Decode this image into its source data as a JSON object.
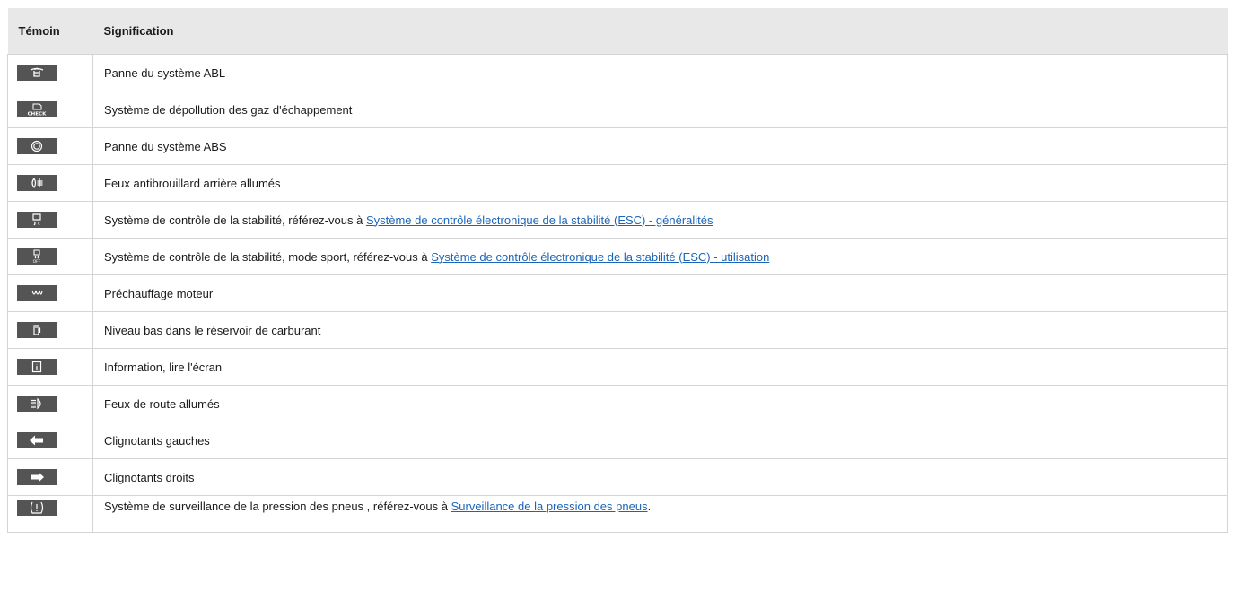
{
  "table": {
    "headers": {
      "temoin": "Témoin",
      "signification": "Signification"
    },
    "rows": [
      {
        "icon": "abl-lamp-fault-icon",
        "text": "Panne du système ABL",
        "link": "",
        "after": ""
      },
      {
        "icon": "engine-check-icon",
        "text": "Système de dépollution des gaz d'échappement",
        "link": "",
        "after": ""
      },
      {
        "icon": "abs-icon",
        "text": "Panne du système ABS",
        "link": "",
        "after": ""
      },
      {
        "icon": "rear-fog-light-icon",
        "text": "Feux antibrouillard arrière allumés",
        "link": "",
        "after": ""
      },
      {
        "icon": "stability-control-icon",
        "text": "Système de contrôle de la stabilité, référez-vous à ",
        "link": "Système de contrôle électronique de la stabilité (ESC) - généralités",
        "after": ""
      },
      {
        "icon": "stability-control-off-icon",
        "text": "Système de contrôle de la stabilité, mode sport, référez-vous à ",
        "link": "Système de contrôle électronique de la stabilité (ESC) - utilisation",
        "after": ""
      },
      {
        "icon": "glow-plug-icon",
        "text": "Préchauffage moteur",
        "link": "",
        "after": ""
      },
      {
        "icon": "fuel-pump-icon",
        "text": "Niveau bas dans le réservoir de carburant",
        "link": "",
        "after": ""
      },
      {
        "icon": "information-icon",
        "text": "Information, lire l'écran",
        "link": "",
        "after": ""
      },
      {
        "icon": "high-beam-icon",
        "text": "Feux de route allumés",
        "link": "",
        "after": ""
      },
      {
        "icon": "left-arrow-icon",
        "text": "Clignotants gauches",
        "link": "",
        "after": ""
      },
      {
        "icon": "right-arrow-icon",
        "text": "Clignotants droits",
        "link": "",
        "after": ""
      },
      {
        "icon": "tire-pressure-icon",
        "text": "Système de surveillance de la pression des pneus , référez-vous à ",
        "link": "Surveillance de la pression des pneus",
        "after": "."
      }
    ]
  }
}
